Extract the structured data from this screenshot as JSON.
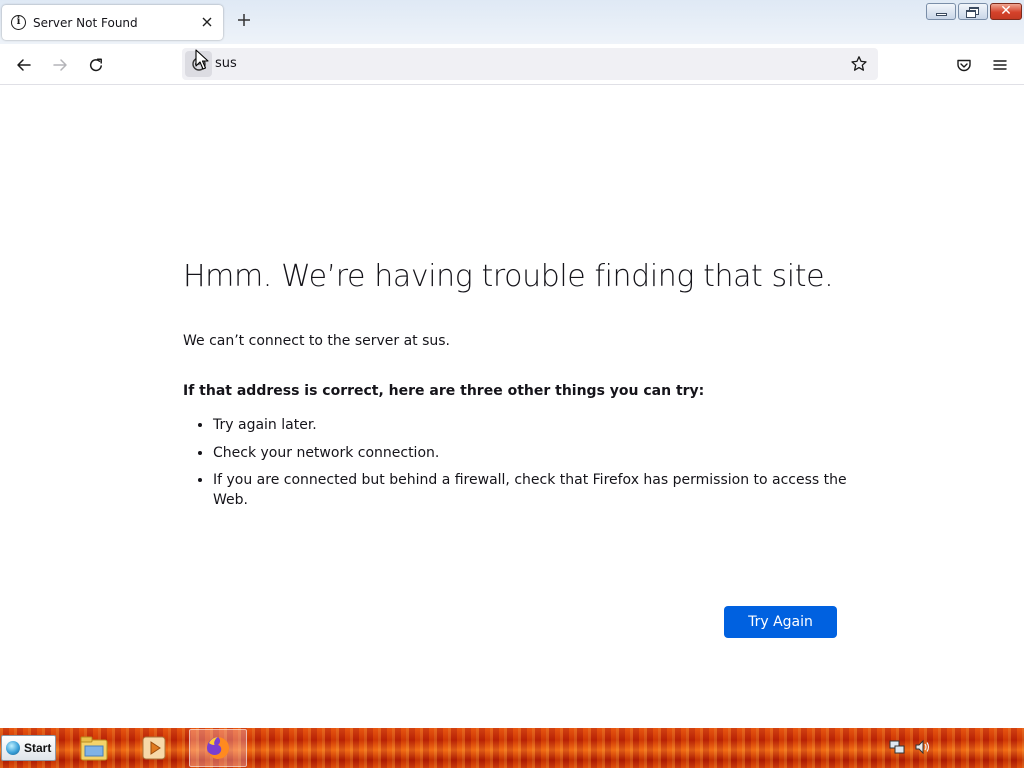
{
  "browser": {
    "tab": {
      "title": "Server Not Found",
      "icon": "info-icon",
      "close_icon": "close-icon"
    },
    "new_tab_icon": "plus-icon",
    "window_controls": [
      "minimize-icon",
      "restore-icon",
      "close-icon"
    ],
    "nav": {
      "back_icon": "arrow-left-icon",
      "forward_icon": "arrow-right-icon",
      "reload_icon": "reload-icon",
      "identity_icon": "page-icon",
      "url": "sus",
      "bookmark_icon": "star-icon",
      "pocket_icon": "pocket-icon",
      "menu_icon": "hamburger-menu-icon"
    }
  },
  "error_page": {
    "title": "Hmm. We’re having trouble finding that site.",
    "description": "We can’t connect to the server at sus.",
    "subheading": "If that address is correct, here are three other things you can try:",
    "suggestions": [
      "Try again later.",
      "Check your network connection.",
      "If you are connected but behind a firewall, check that Firefox has permission to access the Web."
    ],
    "try_again_label": "Try Again",
    "accent_color": "#0061e0"
  },
  "taskbar": {
    "start_label": "Start",
    "pinned": [
      "file-explorer-icon",
      "media-player-icon",
      "firefox-icon"
    ],
    "tray": [
      "network-icon",
      "volume-icon"
    ]
  }
}
